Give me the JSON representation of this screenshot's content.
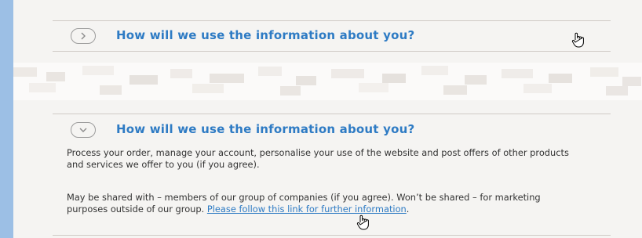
{
  "collapsed_section": {
    "heading": "How will we use the information about you?",
    "state": "collapsed",
    "toggle_icon": "chevron-right-icon"
  },
  "expanded_section": {
    "heading": "How will we use the information about you?",
    "state": "expanded",
    "toggle_icon": "chevron-down-icon",
    "paragraph1": "Process your order, manage your account, personalise your use of the website and post offers of other products and services we offer to you (if you agree).",
    "paragraph2_text": "May be shared with – members of our group of companies (if you agree). Won’t be shared – for marketing purposes outside of our group. ",
    "link_text": "Please follow this link for further information",
    "trailing": "."
  },
  "cursor_icon": "hand-pointer-icon",
  "colors": {
    "outer_background": "#9cbfe5",
    "heading": "#2e7bc4",
    "body_text": "#333333",
    "panel": "#f5f4f2"
  }
}
